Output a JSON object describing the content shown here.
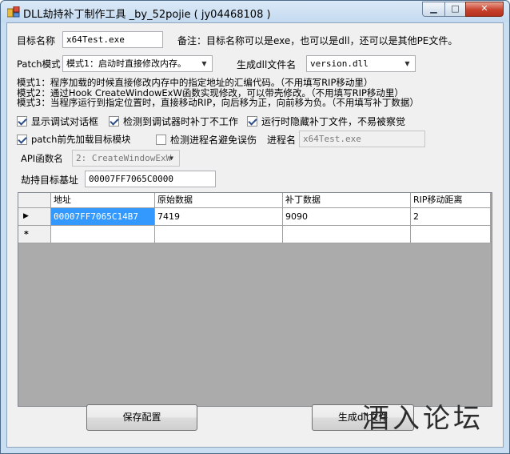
{
  "window": {
    "title": "DLL劫持补丁制作工具 _by_52pojie ( jy04468108 )",
    "min_glyph": "▁",
    "max_glyph": "□",
    "close_glyph": "✕"
  },
  "target": {
    "label": "目标名称",
    "value": "x64Test.exe",
    "note": "备注：目标名称可以是exe，也可以是dll，还可以是其他PE文件。"
  },
  "patch_mode": {
    "label": "Patch模式",
    "selected": "模式1：启动时直接修改内存。",
    "output_label": "生成dll文件名",
    "output_value": "version.dll"
  },
  "mode_notes": [
    "模式1：程序加载的时候直接修改内存中的指定地址的汇编代码。（不用填写RIP移动里）",
    "模式2：通过Hook CreateWindowExW函数实现修改，可以带壳修改。（不用填写RIP移动里）",
    "模式3：当程序运行到指定位置时，直接移动RIP，向后移为正，向前移为负。（不用填写补丁数据）"
  ],
  "options": {
    "show_debug_dialog": {
      "label": "显示调试对话框",
      "checked": true
    },
    "no_patch_on_debugger": {
      "label": "检测到调试器时补丁不工作",
      "checked": true
    },
    "hide_patch_file": {
      "label": "运行时隐藏补丁文件，不易被察觉",
      "checked": true
    },
    "preload_module": {
      "label": "patch前先加载目标模块",
      "checked": true
    },
    "check_process_name": {
      "label": "检测进程名避免误伤",
      "checked": false
    },
    "process_name_label": "进程名",
    "process_name_value": "x64Test.exe"
  },
  "api": {
    "label": "API函数名",
    "selected": "2: CreateWindowExW"
  },
  "base": {
    "label": "劫持目标基址",
    "value": "00007FF7065C0000"
  },
  "grid": {
    "columns": [
      "地址",
      "原始数据",
      "补丁数据",
      "RIP移动距离"
    ],
    "rows": [
      {
        "marker": "▶",
        "cells": [
          "00007FF7065C14B7",
          "7419",
          "9090",
          "2"
        ]
      },
      {
        "marker": "*",
        "cells": [
          "",
          "",
          "",
          ""
        ]
      }
    ]
  },
  "buttons": {
    "save": "保存配置",
    "generate": "生成dll文件"
  },
  "watermark": "酒入论坛"
}
